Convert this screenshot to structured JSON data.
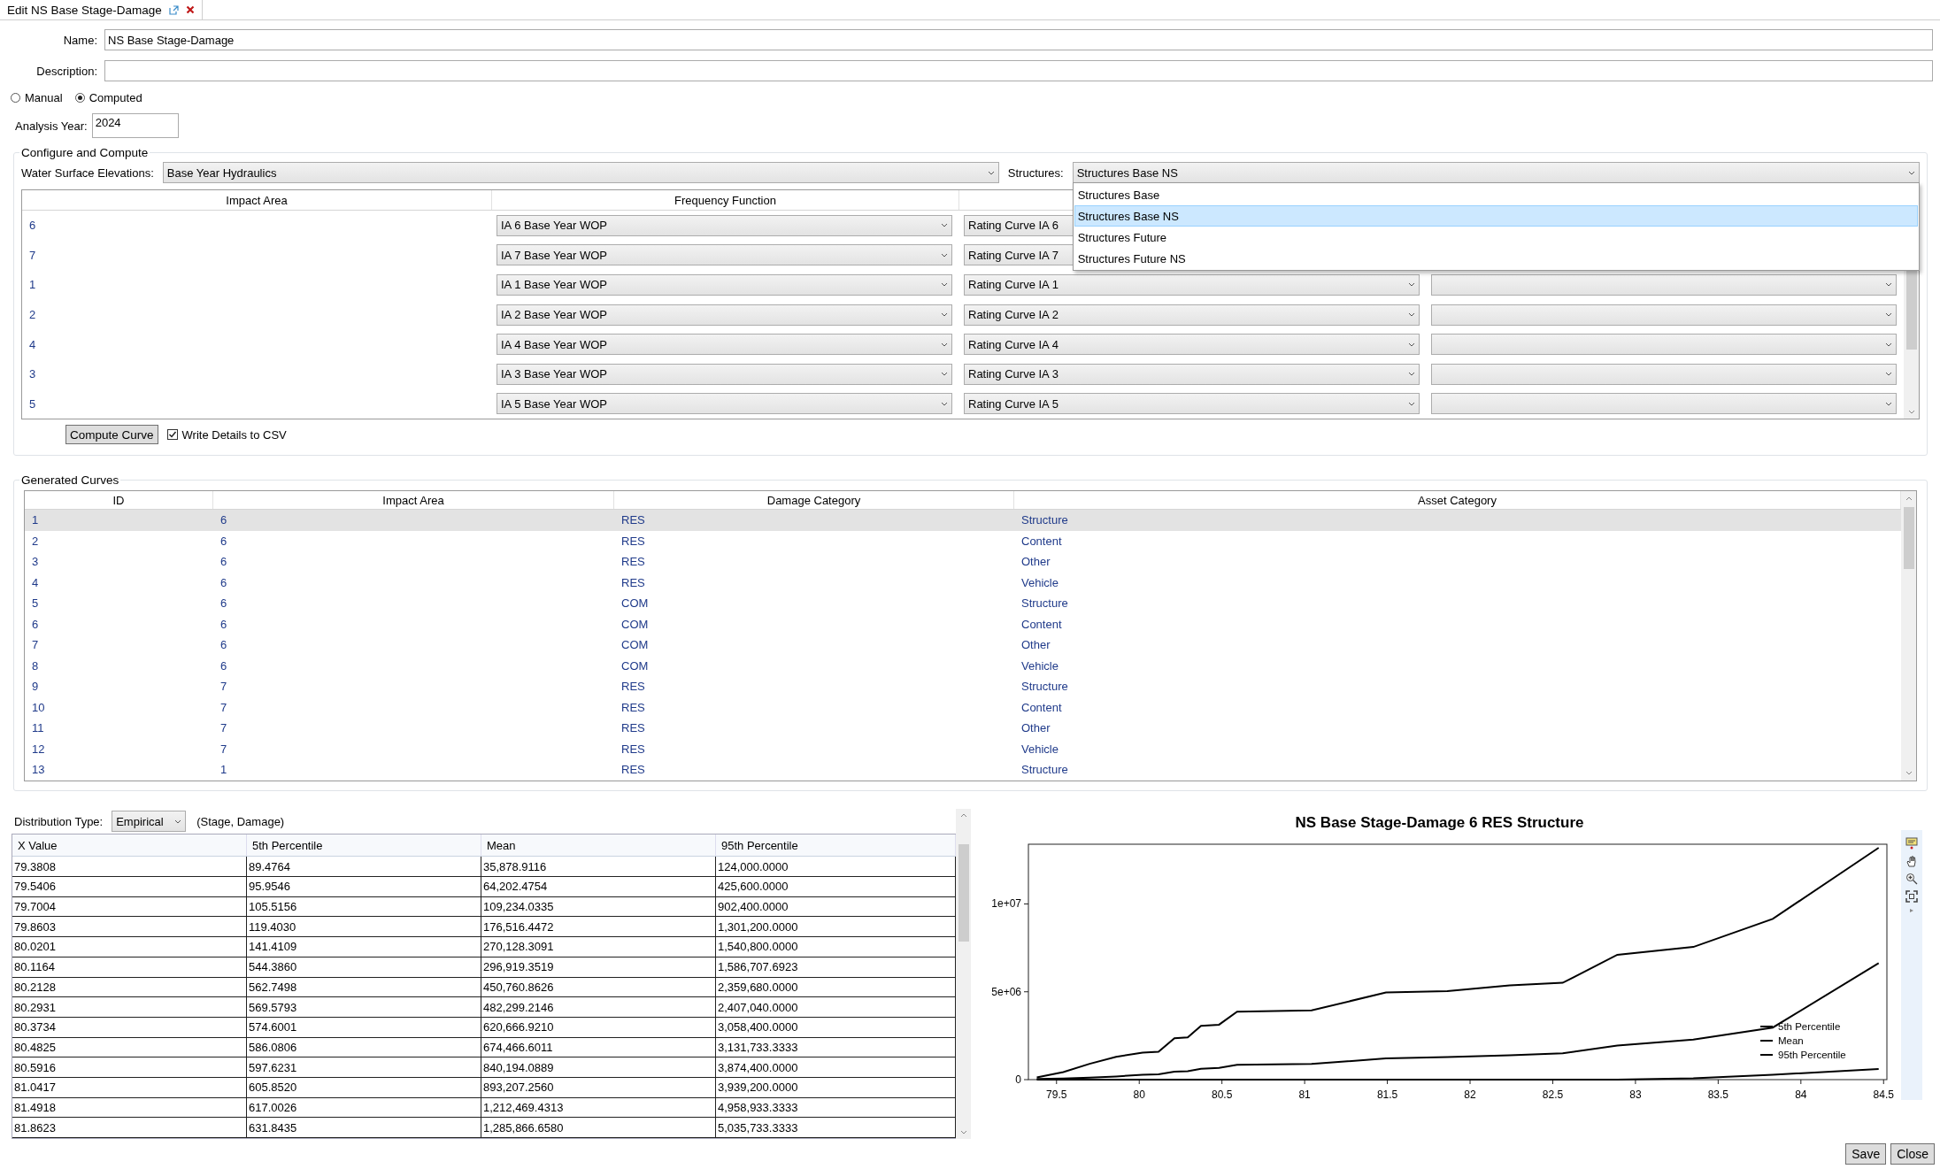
{
  "tab": {
    "title": "Edit NS Base Stage-Damage"
  },
  "form": {
    "name_label": "Name:",
    "name_value": "NS Base Stage-Damage",
    "description_label": "Description:",
    "modes": [
      {
        "label": "Manual",
        "selected": false
      },
      {
        "label": "Computed",
        "selected": true
      }
    ],
    "analysis_year_label": "Analysis Year:",
    "analysis_year_value": "2024"
  },
  "configure": {
    "title": "Configure and Compute",
    "wse_label": "Water Surface Elevations:",
    "wse_value": "Base Year Hydraulics",
    "structures_label": "Structures:",
    "structures_value": "Structures Base NS",
    "structures_options": [
      {
        "label": "Structures Base",
        "selected": false
      },
      {
        "label": "Structures Base NS",
        "selected": true
      },
      {
        "label": "Structures Future",
        "selected": false
      },
      {
        "label": "Structures Future NS",
        "selected": false
      }
    ],
    "columns": [
      "Impact Area",
      "Frequency Function"
    ],
    "rows": [
      {
        "impact_area": "6",
        "frequency_function": "IA 6 Base Year WOP",
        "column_3": "Rating Curve IA 6"
      },
      {
        "impact_area": "7",
        "frequency_function": "IA 7 Base Year WOP",
        "column_3": "Rating Curve IA 7"
      },
      {
        "impact_area": "1",
        "frequency_function": "IA 1 Base Year WOP",
        "column_3": "Rating Curve IA 1"
      },
      {
        "impact_area": "2",
        "frequency_function": "IA 2 Base Year WOP",
        "column_3": "Rating Curve IA 2"
      },
      {
        "impact_area": "4",
        "frequency_function": "IA 4 Base Year WOP",
        "column_3": "Rating Curve IA 4"
      },
      {
        "impact_area": "3",
        "frequency_function": "IA 3 Base Year WOP",
        "column_3": "Rating Curve IA 3"
      },
      {
        "impact_area": "5",
        "frequency_function": "IA 5 Base Year WOP",
        "column_3": "Rating Curve IA 5"
      }
    ],
    "compute_button": "Compute Curve",
    "write_csv": {
      "label": "Write Details to CSV",
      "checked": true
    }
  },
  "generated_curves": {
    "title": "Generated Curves",
    "columns": [
      "ID",
      "Impact Area",
      "Damage Category",
      "Asset Category"
    ],
    "rows": [
      {
        "id": "1",
        "impact_area": "6",
        "damage_category": "RES",
        "asset_category": "Structure",
        "selected": true
      },
      {
        "id": "2",
        "impact_area": "6",
        "damage_category": "RES",
        "asset_category": "Content",
        "selected": false
      },
      {
        "id": "3",
        "impact_area": "6",
        "damage_category": "RES",
        "asset_category": "Other",
        "selected": false
      },
      {
        "id": "4",
        "impact_area": "6",
        "damage_category": "RES",
        "asset_category": "Vehicle",
        "selected": false
      },
      {
        "id": "5",
        "impact_area": "6",
        "damage_category": "COM",
        "asset_category": "Structure",
        "selected": false
      },
      {
        "id": "6",
        "impact_area": "6",
        "damage_category": "COM",
        "asset_category": "Content",
        "selected": false
      },
      {
        "id": "7",
        "impact_area": "6",
        "damage_category": "COM",
        "asset_category": "Other",
        "selected": false
      },
      {
        "id": "8",
        "impact_area": "6",
        "damage_category": "COM",
        "asset_category": "Vehicle",
        "selected": false
      },
      {
        "id": "9",
        "impact_area": "7",
        "damage_category": "RES",
        "asset_category": "Structure",
        "selected": false
      },
      {
        "id": "10",
        "impact_area": "7",
        "damage_category": "RES",
        "asset_category": "Content",
        "selected": false
      },
      {
        "id": "11",
        "impact_area": "7",
        "damage_category": "RES",
        "asset_category": "Other",
        "selected": false
      },
      {
        "id": "12",
        "impact_area": "7",
        "damage_category": "RES",
        "asset_category": "Vehicle",
        "selected": false
      },
      {
        "id": "13",
        "impact_area": "1",
        "damage_category": "RES",
        "asset_category": "Structure",
        "selected": false
      }
    ]
  },
  "distribution": {
    "label": "Distribution Type:",
    "value": "Empirical",
    "note": "(Stage, Damage)",
    "columns": [
      "X Value",
      "5th Percentile",
      "Mean",
      "95th Percentile"
    ],
    "rows": [
      [
        "79.3808",
        "89.4764",
        "35,878.9116",
        "124,000.0000"
      ],
      [
        "79.5406",
        "95.9546",
        "64,202.4754",
        "425,600.0000"
      ],
      [
        "79.7004",
        "105.5156",
        "109,234.0335",
        "902,400.0000"
      ],
      [
        "79.8603",
        "119.4030",
        "176,516.4472",
        "1,301,200.0000"
      ],
      [
        "80.0201",
        "141.4109",
        "270,128.3091",
        "1,540,800.0000"
      ],
      [
        "80.1164",
        "544.3860",
        "296,919.3519",
        "1,586,707.6923"
      ],
      [
        "80.2128",
        "562.7498",
        "450,760.8626",
        "2,359,680.0000"
      ],
      [
        "80.2931",
        "569.5793",
        "482,299.2146",
        "2,407,040.0000"
      ],
      [
        "80.3734",
        "574.6001",
        "620,666.9210",
        "3,058,400.0000"
      ],
      [
        "80.4825",
        "586.0806",
        "674,466.6011",
        "3,131,733.3333"
      ],
      [
        "80.5916",
        "597.6231",
        "840,194.0889",
        "3,874,400.0000"
      ],
      [
        "81.0417",
        "605.8520",
        "893,207.2560",
        "3,939,200.0000"
      ],
      [
        "81.4918",
        "617.0026",
        "1,212,469.4313",
        "4,958,933.3333"
      ],
      [
        "81.8623",
        "631.8435",
        "1,285,866.6580",
        "5,035,733.3333"
      ]
    ]
  },
  "chart": {
    "chart_data": {
      "type": "line",
      "title": "NS Base Stage-Damage 6 RES Structure",
      "x": [
        79.3808,
        79.5406,
        79.7004,
        79.8603,
        80.0201,
        80.1164,
        80.2128,
        80.2931,
        80.3734,
        80.4825,
        80.5916,
        81.0417,
        81.4918,
        81.8623,
        82.24,
        82.56,
        82.89,
        83.35,
        83.83,
        84.47
      ],
      "series": [
        {
          "name": "5th Percentile",
          "color": "#000000",
          "values": [
            0,
            0,
            0,
            0,
            0,
            0,
            0,
            0,
            0,
            0,
            0,
            0,
            0,
            0,
            0,
            0,
            0,
            70000,
            270000,
            610000
          ]
        },
        {
          "name": "Mean",
          "color": "#000000",
          "values": [
            40000,
            60000,
            110000,
            180000,
            270000,
            300000,
            450000,
            480000,
            620000,
            670000,
            840000,
            890000,
            1210000,
            1290000,
            1390000,
            1500000,
            1940000,
            2280000,
            2960000,
            6630000
          ]
        },
        {
          "name": "95th Percentile",
          "color": "#000000",
          "values": [
            120000,
            430000,
            900000,
            1300000,
            1540000,
            1590000,
            2360000,
            2410000,
            3060000,
            3130000,
            3870000,
            3940000,
            4960000,
            5040000,
            5370000,
            5510000,
            7110000,
            7550000,
            9150000,
            13200000
          ]
        }
      ],
      "legend": "lower right",
      "xlim": [
        79.33,
        84.52
      ],
      "ylim": [
        0,
        13400000
      ],
      "xticks": [
        79.5,
        80,
        80.5,
        81,
        81.5,
        82,
        82.5,
        83,
        83.5,
        84,
        84.5
      ],
      "yticks": [
        {
          "value": 0,
          "label": "0"
        },
        {
          "value": 5000000,
          "label": "5e+06"
        },
        {
          "value": 10000000,
          "label": "1e+07"
        }
      ]
    }
  },
  "buttons": [
    "Save",
    "Close"
  ]
}
